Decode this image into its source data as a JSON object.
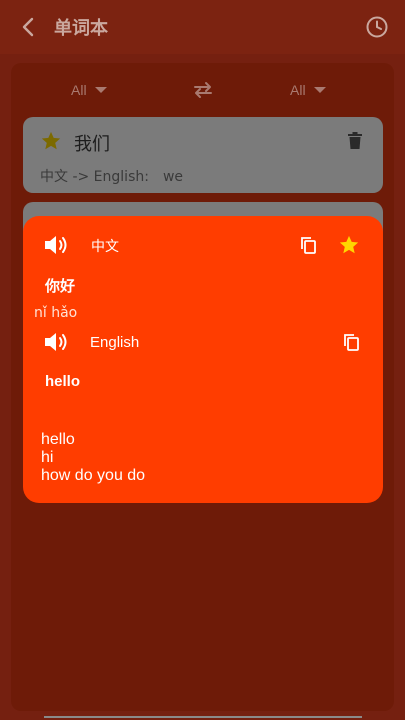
{
  "appbar": {
    "title": "单词本",
    "back_icon": "arrow-left-icon",
    "history_icon": "clock-icon"
  },
  "filters": {
    "source_lang": "All",
    "target_lang": "All",
    "swap_icon": "swap-arrows-icon"
  },
  "word_list": [
    {
      "word": "我们",
      "starred": true,
      "direction": "中文 -> English:",
      "translation": "we"
    }
  ],
  "detail": {
    "source_lang_label": "中文",
    "source_word": "你好",
    "pinyin": "nǐ hǎo",
    "target_lang_label": "English",
    "target_word": "hello",
    "translations": [
      "hello",
      "hi",
      "how do you do"
    ],
    "starred": true
  },
  "colors": {
    "accent": "#ff3d00",
    "star": "#ffd600"
  }
}
